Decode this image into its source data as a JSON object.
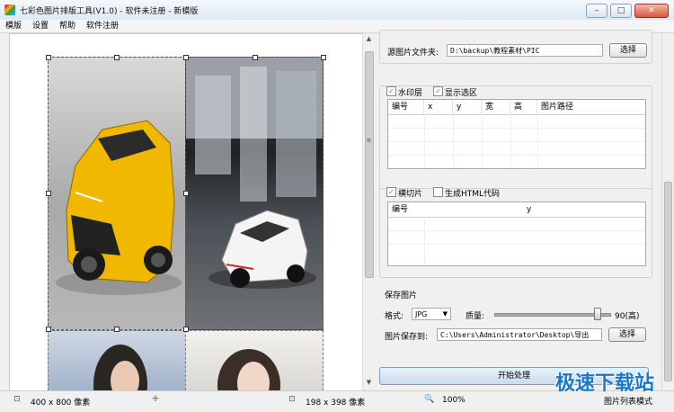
{
  "window": {
    "title": "七彩色图片排版工具(V1.0) - 软件未注册 - 新模版",
    "minimize_label": "–",
    "maximize_label": "□",
    "close_label": "✕"
  },
  "menu": [
    "模版",
    "设置",
    "帮助",
    "软件注册"
  ],
  "source": {
    "label": "源图片文件夹:",
    "path": "D:\\backup\\教程素材\\PIC",
    "button": "选择"
  },
  "watermark_group": {
    "watermark_checkbox": "水印层",
    "watermark_checked": true,
    "show_selection_checkbox": "显示选区",
    "show_selection_checked": true,
    "columns": [
      "编号",
      "x",
      "y",
      "宽",
      "高",
      "图片路径"
    ]
  },
  "slice_group": {
    "slice_checkbox": "横切片",
    "slice_checked": true,
    "html_checkbox": "生成HTML代码",
    "html_checked": false,
    "columns": [
      "编号",
      "y"
    ]
  },
  "save": {
    "section_label": "保存图片",
    "format_label": "格式:",
    "format_value": "JPG",
    "quality_label": "质量:",
    "quality_value": 90,
    "quality_max": 100,
    "quality_text": "90(高)",
    "save_to_label": "图片保存到:",
    "save_path": "C:\\Users\\Administrator\\Desktop\\导出",
    "button": "选择"
  },
  "start_button": "开始处理",
  "status": {
    "canvas_size": "400 x 800 像素",
    "selection_size": "198 x 398 像素",
    "zoom": "100%",
    "mode": "图片列表模式"
  },
  "watermark_text": "极速下载站",
  "icons": {
    "scroll_up": "▲",
    "scroll_down": "▼",
    "grip": "≡",
    "dropdown": "▼",
    "check": "✓",
    "canvas_size_icon": "⊡",
    "move_icon": "✛",
    "selection_icon": "⊡",
    "zoom_icon": "🔍"
  }
}
